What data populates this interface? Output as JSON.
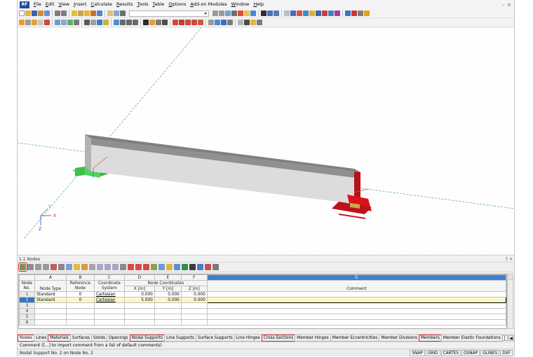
{
  "menu": {
    "logo": "RF",
    "items": [
      "File",
      "Edit",
      "View",
      "Insert",
      "Calculate",
      "Results",
      "Tools",
      "Table",
      "Options",
      "Add-on Modules",
      "Window",
      "Help"
    ]
  },
  "viewport": {
    "axis_labels": {
      "x": "X",
      "y": "Y",
      "z": "Z"
    }
  },
  "panel": {
    "title": "1.1 Nodes",
    "pin": "† ×"
  },
  "table": {
    "col_letters": [
      "A",
      "B",
      "C",
      "D",
      "E",
      "F",
      "G"
    ],
    "header": {
      "node_no": "Node No.",
      "node_type": "Node Type",
      "reference_node": "Reference Node",
      "coordinate_system": "Coordinate System",
      "node_coordinates": "Node Coordinates",
      "x": "X [m]",
      "y": "Y [m]",
      "z": "Z [m]",
      "comment": "Comment"
    },
    "rows": [
      {
        "no": "1",
        "type": "Standard",
        "ref": "0",
        "system": "Cartesian",
        "x": "0.000",
        "y": "0.000",
        "z": "0.000",
        "comment": ""
      },
      {
        "no": "2",
        "type": "Standard",
        "ref": "0",
        "system": "Cartesian",
        "x": "5.000",
        "y": "0.000",
        "z": "0.000",
        "comment": ""
      },
      {
        "no": "3",
        "type": "",
        "ref": "",
        "system": "",
        "x": "",
        "y": "",
        "z": "",
        "comment": ""
      },
      {
        "no": "4",
        "type": "",
        "ref": "",
        "system": "",
        "x": "",
        "y": "",
        "z": "",
        "comment": ""
      },
      {
        "no": "5",
        "type": "",
        "ref": "",
        "system": "",
        "x": "",
        "y": "",
        "z": "",
        "comment": ""
      },
      {
        "no": "6",
        "type": "",
        "ref": "",
        "system": "",
        "x": "",
        "y": "",
        "z": "",
        "comment": ""
      }
    ]
  },
  "tabs": [
    {
      "label": "Nodes",
      "active": true,
      "highlighted": true
    },
    {
      "label": "Lines",
      "highlighted": false
    },
    {
      "label": "Materials",
      "highlighted": true
    },
    {
      "label": "Surfaces",
      "highlighted": false
    },
    {
      "label": "Solids",
      "highlighted": false
    },
    {
      "label": "Openings",
      "highlighted": false
    },
    {
      "label": "Nodal Supports",
      "highlighted": true
    },
    {
      "label": "Line Supports",
      "highlighted": false
    },
    {
      "label": "Surface Supports",
      "highlighted": false
    },
    {
      "label": "Line Hinges",
      "highlighted": false
    },
    {
      "label": "Cross-Sections",
      "highlighted": true
    },
    {
      "label": "Member Hinges",
      "highlighted": false
    },
    {
      "label": "Member Eccentricities",
      "highlighted": false
    },
    {
      "label": "Member Divisions",
      "highlighted": false
    },
    {
      "label": "Members",
      "highlighted": true
    },
    {
      "label": "Member Elastic Foundations",
      "highlighted": false
    }
  ],
  "tab_nav": [
    "|◀",
    "◀",
    "▶",
    "▶|"
  ],
  "hint": "Comment ([...] to import comment from a list of default comments)",
  "status": {
    "text": "Nodal Support No. 2 on Node No. 2",
    "toggles": [
      "SNAP",
      "GRID",
      "CARTES",
      "OSNAP",
      "GLINES",
      "DXF"
    ]
  },
  "colors": {
    "highlight": "#e1232b",
    "support_green": "#52d45a",
    "support_red": "#d8141d",
    "beam_top": "#8f9191",
    "beam_front": "#dcdcdc",
    "grid_line": "#2e9b63",
    "selected_row": "#fbf8c8",
    "column_g": "#3b7fd1"
  },
  "icons": {
    "toolbar": [
      "new-icon",
      "open-icon",
      "save-icon",
      "print-icon",
      "undo-icon",
      "redo-icon",
      "zoom-icon",
      "render-icon",
      "support-icon",
      "member-icon"
    ],
    "panel_toolbar": [
      "table-icon",
      "filter-icon",
      "excel-icon",
      "sort-icon",
      "delete-row-icon",
      "insert-row-icon",
      "function-icon",
      "settings-icon"
    ]
  }
}
